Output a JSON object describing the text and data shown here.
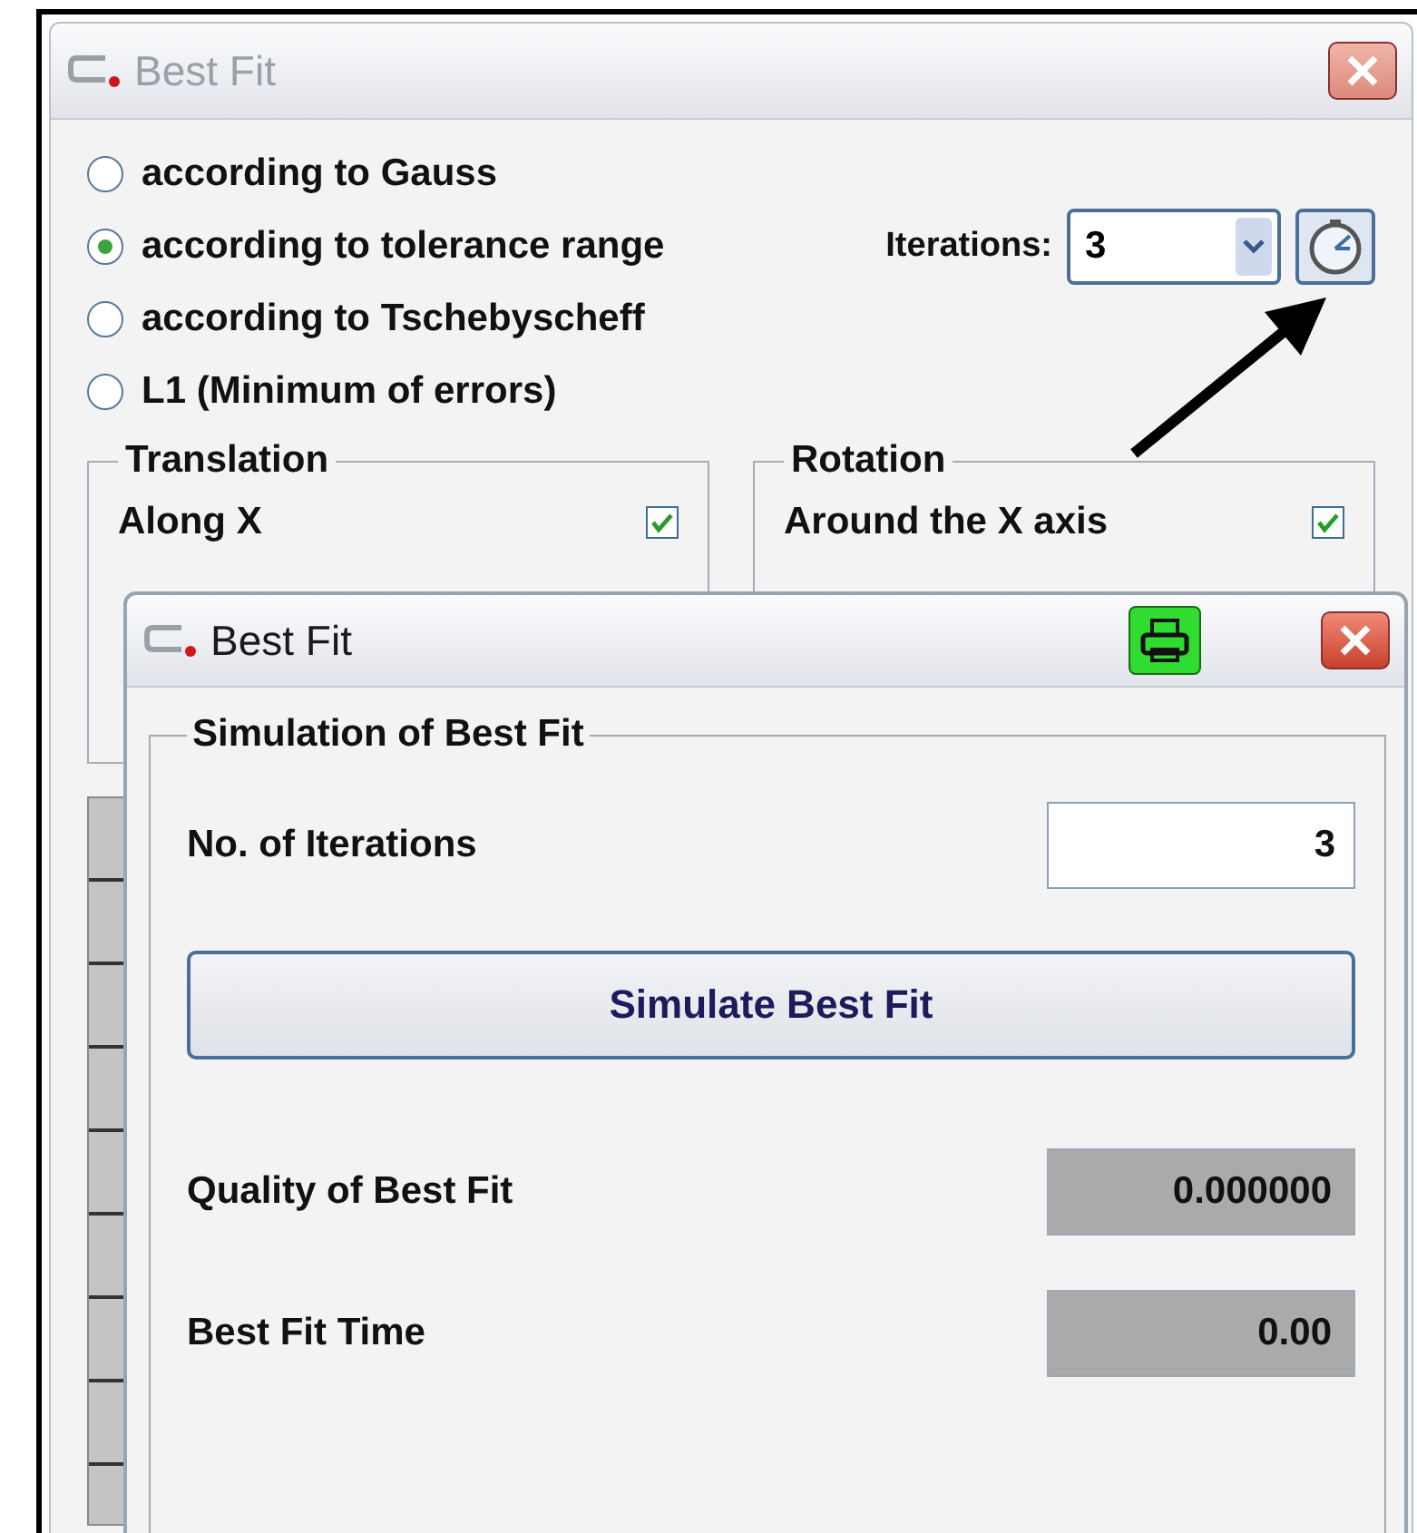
{
  "back_window": {
    "title": "Best Fit",
    "methods": [
      {
        "label": "according to Gauss",
        "selected": false
      },
      {
        "label": "according to tolerance range",
        "selected": true
      },
      {
        "label": "according to Tschebyscheff",
        "selected": false
      },
      {
        "label": "L1 (Minimum of errors)",
        "selected": false
      }
    ],
    "iterations": {
      "label": "Iterations:",
      "value": "3"
    },
    "translation": {
      "title": "Translation",
      "items": [
        {
          "label": "Along X",
          "checked": true
        }
      ]
    },
    "rotation": {
      "title": "Rotation",
      "items": [
        {
          "label": "Around the X axis",
          "checked": true
        }
      ]
    }
  },
  "front_window": {
    "title": "Best Fit",
    "group_title": "Simulation of Best Fit",
    "fields": [
      {
        "label": "No. of Iterations",
        "value": "3",
        "kind": "input"
      },
      {
        "label": "Simulate Best Fit",
        "kind": "button"
      },
      {
        "label": "Quality of Best Fit",
        "value": "0.000000",
        "kind": "readonly"
      },
      {
        "label": "Best Fit Time",
        "value": "0.00",
        "kind": "readonly"
      }
    ]
  }
}
